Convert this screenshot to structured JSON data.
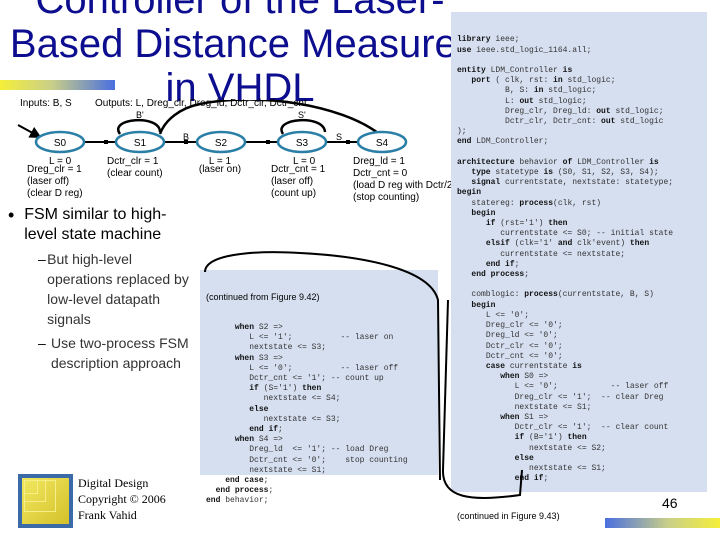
{
  "slide": {
    "title": "Controller of the Laser-Based Distance Measurer in VHDL",
    "page_number": "46"
  },
  "fsm": {
    "inputs_label": "Inputs: B, S",
    "outputs_label": "Outputs: L, Dreg_clr, Dreg_ld, Dctr_clr, Dctr_cnt",
    "states": [
      {
        "name": "S0",
        "lines": [
          "L = 0",
          "Dreg_clr = 1",
          "(laser off)",
          "(clear D reg)"
        ]
      },
      {
        "name": "S1",
        "lines": [
          "Dctr_clr = 1",
          "(clear count)"
        ]
      },
      {
        "name": "S2",
        "lines": [
          "L = 1",
          "(laser on)"
        ]
      },
      {
        "name": "S3",
        "lines": [
          "L = 0",
          "Dctr_cnt = 1",
          "(laser off)",
          "(count up)"
        ]
      },
      {
        "name": "S4",
        "lines": [
          "Dreg_ld = 1",
          "Dctr_cnt = 0",
          "(load D reg with Dctr/2)",
          "(stop counting)"
        ]
      }
    ],
    "transitions": {
      "s1_self": "B'",
      "s1_to_s2": "B",
      "s3_self": "S'",
      "s3_to_s4": "S"
    }
  },
  "bullets": {
    "main": "FSM similar to high-level state machine",
    "subs": [
      "But high-level operations replaced by low-level datapath signals",
      "Use two-process FSM description approach"
    ]
  },
  "code_main": {
    "lines": [
      "library ieee;",
      "use ieee.std_logic_1164.all;",
      "",
      "entity LDM_Controller is",
      "   port ( clk, rst: in std_logic;",
      "          B, S: in std_logic;",
      "          L: out std_logic;",
      "          Dreg_clr, Dreg_ld: out std_logic;",
      "          Dctr_clr, Dctr_cnt: out std_logic",
      ");",
      "end LDM_Controller;",
      "",
      "architecture behavior of LDM_Controller is",
      "   type statetype is (S0, S1, S2, S3, S4);",
      "   signal currentstate, nextstate: statetype;",
      "begin",
      "   statereg: process(clk, rst)",
      "   begin",
      "      if (rst='1') then",
      "         currentstate <= S0; -- initial state",
      "      elsif (clk='1' and clk'event) then",
      "         currentstate <= nextstate;",
      "      end if;",
      "   end process;",
      "",
      "   comblogic: process(currentstate, B, S)",
      "   begin",
      "      L <= '0';",
      "      Dreg_clr <= '0';",
      "      Dreg_ld <= '0';",
      "      Dctr_clr <= '0';",
      "      Dctr_cnt <= '0';",
      "      case currentstate is",
      "         when S0 =>",
      "            L <= '0';           -- laser off",
      "            Dreg_clr <= '1';  -- clear Dreg",
      "            nextstate <= S1;",
      "         when S1 =>",
      "            Dctr_clr <= '1';  -- clear count",
      "            if (B='1') then",
      "               nextstate <= S2;",
      "            else",
      "               nextstate <= S1;",
      "            end if;"
    ],
    "note": "(continued in Figure 9.43)"
  },
  "code_cont": {
    "note": "(continued from Figure 9.42)",
    "lines": [
      "      when S2 =>",
      "         L <= '1';          -- laser on",
      "         nextstate <= S3;",
      "      when S3 =>",
      "         L <= '0';          -- laser off",
      "         Dctr_cnt <= '1'; -- count up",
      "         if (S='1') then",
      "            nextstate <= S4;",
      "         else",
      "            nextstate <= S3;",
      "         end if;",
      "      when S4 =>",
      "         Dreg_ld  <= '1'; -- load Dreg",
      "         Dctr_cnt <= '0';    stop counting",
      "         nextstate <= S1;",
      "    end case;",
      "  end process;",
      "end behavior;"
    ]
  },
  "footer": {
    "copyright_lines": [
      "Digital Design",
      "Copyright © 2006",
      "Frank Vahid"
    ]
  },
  "colors": {
    "title": "#0d0d8f",
    "state_stroke": "#2b7fa6",
    "code_bg": "#d6dff0"
  }
}
